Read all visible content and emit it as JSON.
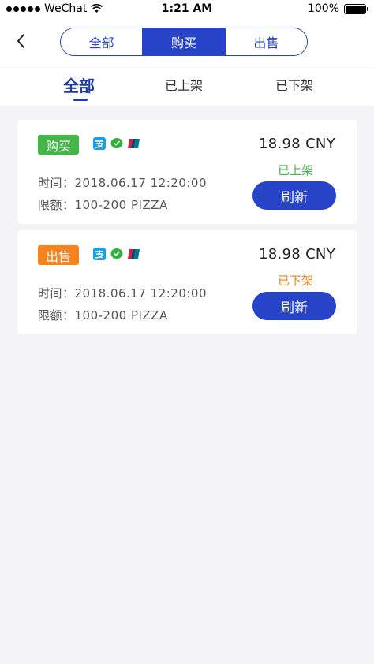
{
  "status_bar": {
    "carrier": "WeChat",
    "time": "1:21 AM",
    "battery": "100%",
    "battery_level": 1.0
  },
  "nav": {
    "segments": [
      {
        "label": "全部",
        "active": false
      },
      {
        "label": "购买",
        "active": true
      },
      {
        "label": "出售",
        "active": false
      }
    ]
  },
  "tabs": [
    {
      "label": "全部",
      "active": true
    },
    {
      "label": "已上架",
      "active": false
    },
    {
      "label": "已下架",
      "active": false
    }
  ],
  "orders": [
    {
      "type": "购买",
      "type_color": "#44b549",
      "payment_icons": [
        "alipay-icon",
        "wechat-pay-icon",
        "unionpay-icon"
      ],
      "time": "时间：2018.06.17 12:20:00",
      "limit": "限额：100-200 PIZZA",
      "price": "18.98 CNY",
      "status": "已上架",
      "status_color": "#44b549",
      "refresh_label": "刷新"
    },
    {
      "type": "出售",
      "type_color": "#f5841f",
      "payment_icons": [
        "alipay-icon",
        "wechat-pay-icon",
        "unionpay-icon"
      ],
      "time": "时间：2018.06.17 12:20:00",
      "limit": "限额：100-200 PIZZA",
      "price": "18.98 CNY",
      "status": "已下架",
      "status_color": "#f5841f",
      "refresh_label": "刷新"
    }
  ],
  "colors": {
    "primary": "#2743c8",
    "tab_active": "#1c3aa9",
    "background": "#f4f4f7"
  }
}
